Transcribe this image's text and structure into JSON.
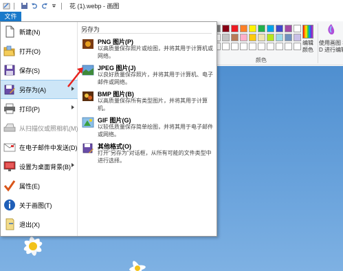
{
  "window": {
    "title": "花 (1).webp - 画图"
  },
  "file_tab": {
    "label": "文件"
  },
  "ribbon": {
    "colors_group_label": "颜色",
    "edit_colors_label_1": "编辑",
    "edit_colors_label_2": "颜色",
    "paint3d_label_1": "使用画图 3",
    "paint3d_label_2": "D 进行编辑"
  },
  "palette": {
    "row1": [
      "#ffffff",
      "#c3c3c3",
      "#b97a57",
      "#ffaec9",
      "#ffc90e",
      "#efe4b0",
      "#b5e61d",
      "#99d9ea",
      "#7092be",
      "#c8bfe7"
    ],
    "row2": [
      "#ffffff",
      "#ffffff",
      "#ffffff",
      "#ffffff",
      "#ffffff",
      "#ffffff",
      "#ffffff",
      "#ffffff",
      "#ffffff",
      "#ffffff"
    ],
    "row0": [
      "#7f7f7f",
      "#880015",
      "#ed1c24",
      "#ff7f27",
      "#fff200",
      "#22b14c",
      "#00a2e8",
      "#3f48cc",
      "#a349a4",
      "#ffffff"
    ]
  },
  "file_menu": {
    "items": [
      {
        "label": "新建(N)",
        "icon": "new-file-icon"
      },
      {
        "label": "打开(O)",
        "icon": "open-folder-icon"
      },
      {
        "label": "保存(S)",
        "icon": "save-icon"
      },
      {
        "label": "另存为(A)",
        "icon": "save-as-icon"
      },
      {
        "label": "打印(P)",
        "icon": "printer-icon"
      },
      {
        "label": "从扫描仪或照相机(M)",
        "icon": "scanner-icon"
      },
      {
        "label": "在电子邮件中发送(D)",
        "icon": "email-icon"
      },
      {
        "label": "设置为桌面背景(B)",
        "icon": "desktop-background-icon"
      },
      {
        "label": "属性(E)",
        "icon": "checkmark-icon"
      },
      {
        "label": "关于画图(T)",
        "icon": "info-icon"
      },
      {
        "label": "退出(X)",
        "icon": "exit-icon"
      }
    ],
    "save_as_panel": {
      "title": "另存为",
      "options": [
        {
          "title": "PNG 图片(P)",
          "desc": "以高质量保存照片或绘图，并将其用于计算机或网络。",
          "icon": "png-icon"
        },
        {
          "title": "JPEG 图片(J)",
          "desc": "以良好质量保存照片，并将其用于计算机、电子邮件或网络。",
          "icon": "jpeg-icon"
        },
        {
          "title": "BMP 图片(B)",
          "desc": "以高质量保存所有类型图片，并将其用于计算机。",
          "icon": "bmp-icon"
        },
        {
          "title": "GIF 图片(G)",
          "desc": "以较低质量保存简单绘图，并将其用于电子邮件或网络。",
          "icon": "gif-icon"
        },
        {
          "title": "其他格式(O)",
          "desc": "打开\"另存为\"对话框，从所有可能的文件类型中进行选择。",
          "icon": "other-formats-icon"
        }
      ]
    }
  }
}
